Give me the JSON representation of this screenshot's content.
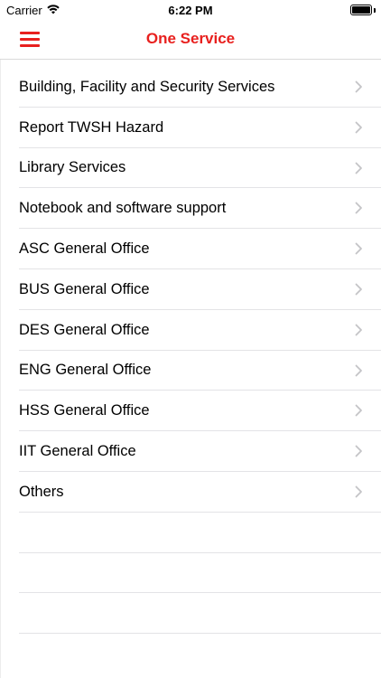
{
  "status_bar": {
    "carrier": "Carrier",
    "time": "6:22 PM",
    "icons": [
      "wifi-icon",
      "battery-icon"
    ]
  },
  "nav": {
    "title": "One Service",
    "menu_icon": "hamburger-menu-icon",
    "accent_color": "#e8201e"
  },
  "services": [
    {
      "label": "Building, Facility and Security Services"
    },
    {
      "label": "Report TWSH Hazard"
    },
    {
      "label": "Library Services"
    },
    {
      "label": "Notebook and software support"
    },
    {
      "label": "ASC General Office"
    },
    {
      "label": "BUS General Office"
    },
    {
      "label": "DES General Office"
    },
    {
      "label": "ENG General Office"
    },
    {
      "label": "HSS General Office"
    },
    {
      "label": "IIT General Office"
    },
    {
      "label": "Others"
    }
  ],
  "row_icon": "chevron-right-icon"
}
